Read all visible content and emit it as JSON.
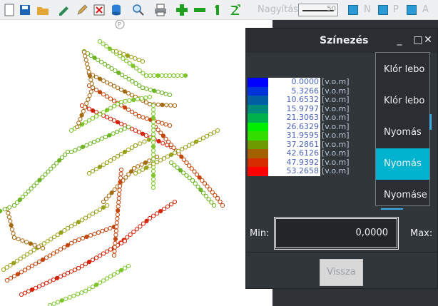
{
  "toolbar": {
    "zoom_label": "Nagyítás:",
    "zoom_value": "50",
    "check_labels": [
      "N",
      "P",
      "A"
    ],
    "icons": [
      "new-icon",
      "save-icon",
      "open-icon",
      "edit-icon",
      "pen-icon",
      "delete-icon",
      "database-icon",
      "search-icon",
      "print-icon",
      "plus-icon",
      "minus-icon",
      "number-one-icon",
      "number-two-icon"
    ]
  },
  "dialog": {
    "title": "Színezés",
    "legend": [
      {
        "value": "0.0000",
        "unit": "[v.o.m]",
        "color": "#0000ff"
      },
      {
        "value": "5.3266",
        "unit": "[v.o.m]",
        "color": "#0033dd"
      },
      {
        "value": "10.6532",
        "unit": "[v.o.m]",
        "color": "#005fa3"
      },
      {
        "value": "15.9797",
        "unit": "[v.o.m]",
        "color": "#008a7a"
      },
      {
        "value": "21.3063",
        "unit": "[v.o.m]",
        "color": "#00b24c"
      },
      {
        "value": "26.6329",
        "unit": "[v.o.m]",
        "color": "#00ee00"
      },
      {
        "value": "31.9595",
        "unit": "[v.o.m]",
        "color": "#33dd00"
      },
      {
        "value": "37.2861",
        "unit": "[v.o.m]",
        "color": "#6e9a00"
      },
      {
        "value": "42.6126",
        "unit": "[v.o.m]",
        "color": "#a36000"
      },
      {
        "value": "47.9392",
        "unit": "[v.o.m]",
        "color": "#d62d00"
      },
      {
        "value": "53.2658",
        "unit": "[v.o.m]",
        "color": "#ff0000"
      }
    ],
    "options": [
      {
        "label": "Klór lebo",
        "selected": false
      },
      {
        "label": "Klór lebo",
        "selected": false
      },
      {
        "label": "Nyomás",
        "selected": false
      },
      {
        "label": "Nyomás",
        "selected": true
      },
      {
        "label": "Nyomáse",
        "selected": false
      }
    ],
    "min_label": "Min:",
    "min_value": "0,0000",
    "max_label": "Max:",
    "back_button": "Vissza"
  },
  "colors": {
    "accent": "#00b3cf",
    "dialog_bg": "#31363b"
  }
}
